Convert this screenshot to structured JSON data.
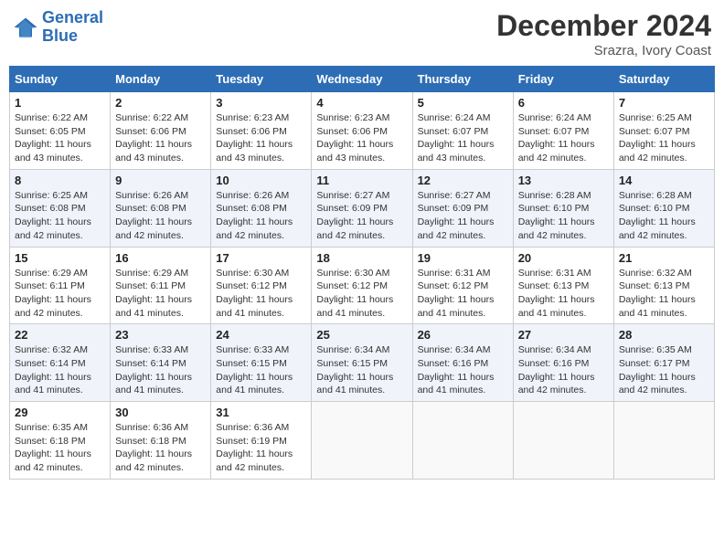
{
  "header": {
    "logo_line1": "General",
    "logo_line2": "Blue",
    "month": "December 2024",
    "location": "Srazra, Ivory Coast"
  },
  "weekdays": [
    "Sunday",
    "Monday",
    "Tuesday",
    "Wednesday",
    "Thursday",
    "Friday",
    "Saturday"
  ],
  "weeks": [
    [
      {
        "day": "1",
        "sunrise": "6:22 AM",
        "sunset": "6:05 PM",
        "daylight": "11 hours and 43 minutes."
      },
      {
        "day": "2",
        "sunrise": "6:22 AM",
        "sunset": "6:06 PM",
        "daylight": "11 hours and 43 minutes."
      },
      {
        "day": "3",
        "sunrise": "6:23 AM",
        "sunset": "6:06 PM",
        "daylight": "11 hours and 43 minutes."
      },
      {
        "day": "4",
        "sunrise": "6:23 AM",
        "sunset": "6:06 PM",
        "daylight": "11 hours and 43 minutes."
      },
      {
        "day": "5",
        "sunrise": "6:24 AM",
        "sunset": "6:07 PM",
        "daylight": "11 hours and 43 minutes."
      },
      {
        "day": "6",
        "sunrise": "6:24 AM",
        "sunset": "6:07 PM",
        "daylight": "11 hours and 42 minutes."
      },
      {
        "day": "7",
        "sunrise": "6:25 AM",
        "sunset": "6:07 PM",
        "daylight": "11 hours and 42 minutes."
      }
    ],
    [
      {
        "day": "8",
        "sunrise": "6:25 AM",
        "sunset": "6:08 PM",
        "daylight": "11 hours and 42 minutes."
      },
      {
        "day": "9",
        "sunrise": "6:26 AM",
        "sunset": "6:08 PM",
        "daylight": "11 hours and 42 minutes."
      },
      {
        "day": "10",
        "sunrise": "6:26 AM",
        "sunset": "6:08 PM",
        "daylight": "11 hours and 42 minutes."
      },
      {
        "day": "11",
        "sunrise": "6:27 AM",
        "sunset": "6:09 PM",
        "daylight": "11 hours and 42 minutes."
      },
      {
        "day": "12",
        "sunrise": "6:27 AM",
        "sunset": "6:09 PM",
        "daylight": "11 hours and 42 minutes."
      },
      {
        "day": "13",
        "sunrise": "6:28 AM",
        "sunset": "6:10 PM",
        "daylight": "11 hours and 42 minutes."
      },
      {
        "day": "14",
        "sunrise": "6:28 AM",
        "sunset": "6:10 PM",
        "daylight": "11 hours and 42 minutes."
      }
    ],
    [
      {
        "day": "15",
        "sunrise": "6:29 AM",
        "sunset": "6:11 PM",
        "daylight": "11 hours and 42 minutes."
      },
      {
        "day": "16",
        "sunrise": "6:29 AM",
        "sunset": "6:11 PM",
        "daylight": "11 hours and 41 minutes."
      },
      {
        "day": "17",
        "sunrise": "6:30 AM",
        "sunset": "6:12 PM",
        "daylight": "11 hours and 41 minutes."
      },
      {
        "day": "18",
        "sunrise": "6:30 AM",
        "sunset": "6:12 PM",
        "daylight": "11 hours and 41 minutes."
      },
      {
        "day": "19",
        "sunrise": "6:31 AM",
        "sunset": "6:12 PM",
        "daylight": "11 hours and 41 minutes."
      },
      {
        "day": "20",
        "sunrise": "6:31 AM",
        "sunset": "6:13 PM",
        "daylight": "11 hours and 41 minutes."
      },
      {
        "day": "21",
        "sunrise": "6:32 AM",
        "sunset": "6:13 PM",
        "daylight": "11 hours and 41 minutes."
      }
    ],
    [
      {
        "day": "22",
        "sunrise": "6:32 AM",
        "sunset": "6:14 PM",
        "daylight": "11 hours and 41 minutes."
      },
      {
        "day": "23",
        "sunrise": "6:33 AM",
        "sunset": "6:14 PM",
        "daylight": "11 hours and 41 minutes."
      },
      {
        "day": "24",
        "sunrise": "6:33 AM",
        "sunset": "6:15 PM",
        "daylight": "11 hours and 41 minutes."
      },
      {
        "day": "25",
        "sunrise": "6:34 AM",
        "sunset": "6:15 PM",
        "daylight": "11 hours and 41 minutes."
      },
      {
        "day": "26",
        "sunrise": "6:34 AM",
        "sunset": "6:16 PM",
        "daylight": "11 hours and 41 minutes."
      },
      {
        "day": "27",
        "sunrise": "6:34 AM",
        "sunset": "6:16 PM",
        "daylight": "11 hours and 42 minutes."
      },
      {
        "day": "28",
        "sunrise": "6:35 AM",
        "sunset": "6:17 PM",
        "daylight": "11 hours and 42 minutes."
      }
    ],
    [
      {
        "day": "29",
        "sunrise": "6:35 AM",
        "sunset": "6:18 PM",
        "daylight": "11 hours and 42 minutes."
      },
      {
        "day": "30",
        "sunrise": "6:36 AM",
        "sunset": "6:18 PM",
        "daylight": "11 hours and 42 minutes."
      },
      {
        "day": "31",
        "sunrise": "6:36 AM",
        "sunset": "6:19 PM",
        "daylight": "11 hours and 42 minutes."
      },
      null,
      null,
      null,
      null
    ]
  ]
}
